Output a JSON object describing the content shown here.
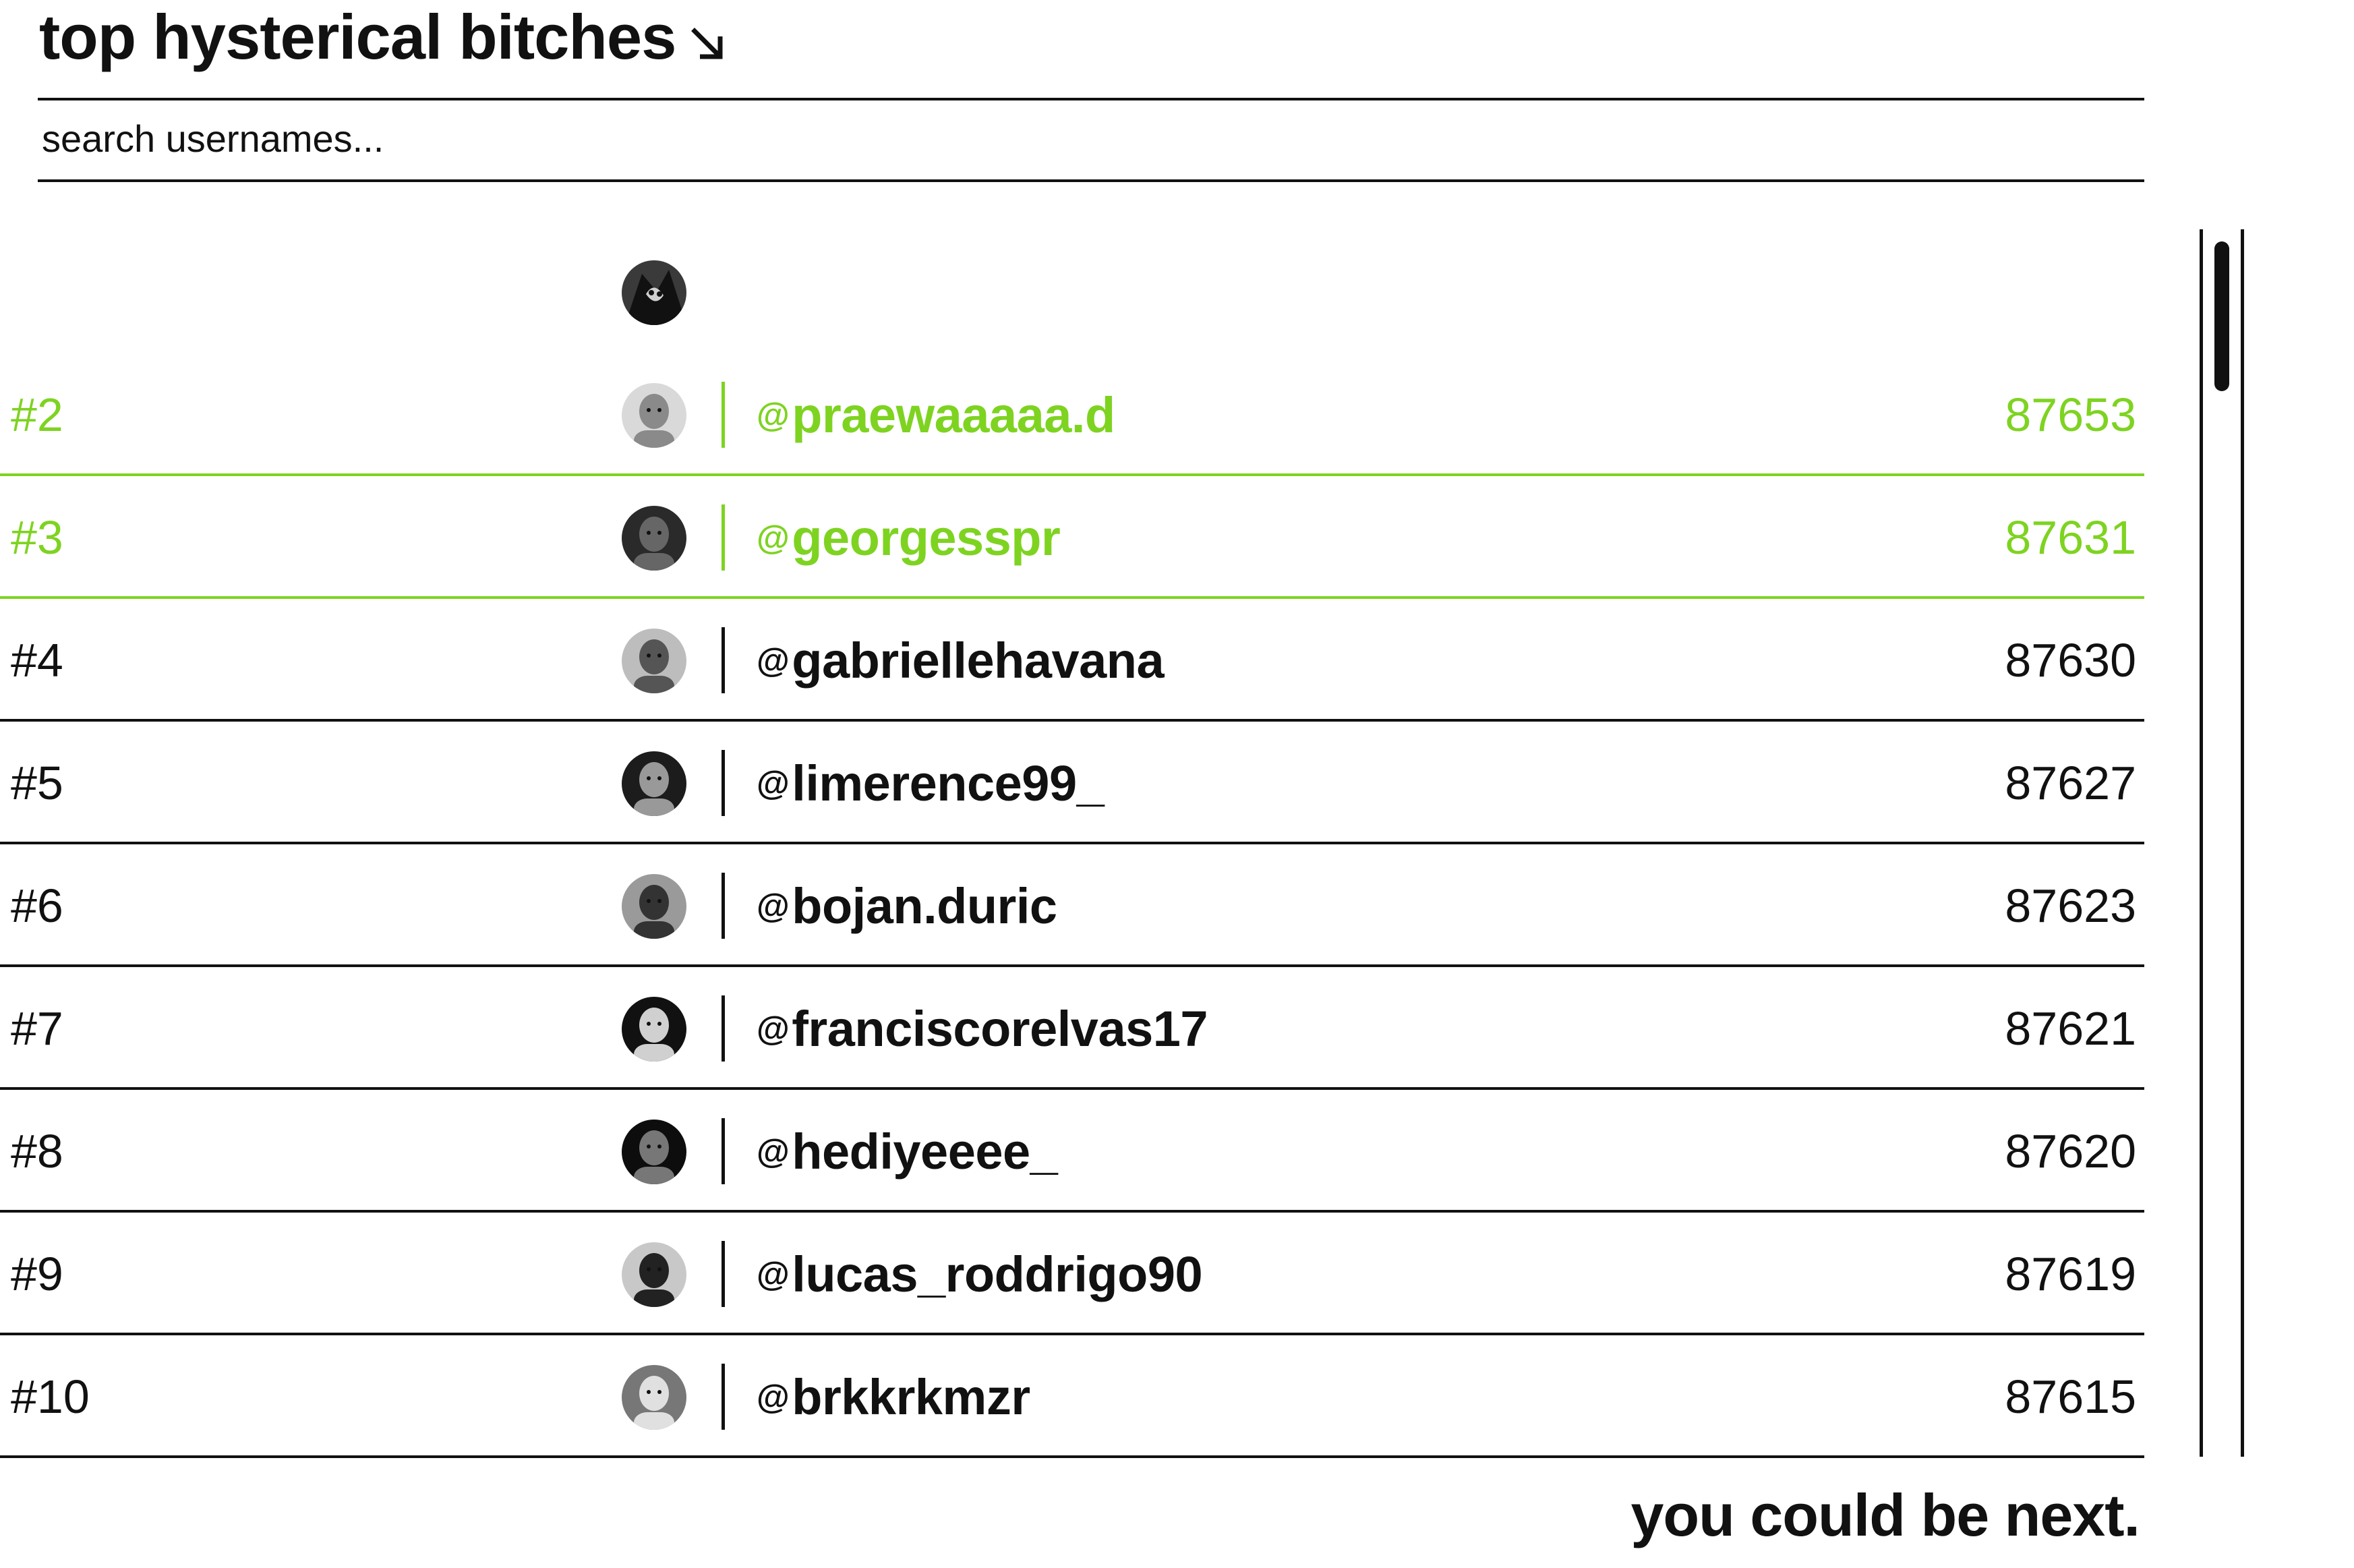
{
  "header": {
    "title": "top hysterical bitches",
    "title_icon": "arrow-down-right-icon"
  },
  "search": {
    "placeholder": "search usernames..."
  },
  "colors": {
    "accent": "#7ed321",
    "text": "#111111",
    "background": "#ffffff"
  },
  "leaderboard": {
    "top_avatar_icon": "avatar-rank-1",
    "rows": [
      {
        "rank": "#2",
        "at": "@",
        "username": "praewaaaaa.d",
        "score": "87653",
        "highlighted": true
      },
      {
        "rank": "#3",
        "at": "@",
        "username": "georgesspr",
        "score": "87631",
        "highlighted": true
      },
      {
        "rank": "#4",
        "at": "@",
        "username": "gabriellehavana",
        "score": "87630",
        "highlighted": false
      },
      {
        "rank": "#5",
        "at": "@",
        "username": "limerence99_",
        "score": "87627",
        "highlighted": false
      },
      {
        "rank": "#6",
        "at": "@",
        "username": "bojan.duric",
        "score": "87623",
        "highlighted": false
      },
      {
        "rank": "#7",
        "at": "@",
        "username": "franciscorelvas17",
        "score": "87621",
        "highlighted": false
      },
      {
        "rank": "#8",
        "at": "@",
        "username": "hediyeeee_",
        "score": "87620",
        "highlighted": false
      },
      {
        "rank": "#9",
        "at": "@",
        "username": "lucas_roddrigo90",
        "score": "87619",
        "highlighted": false
      },
      {
        "rank": "#10",
        "at": "@",
        "username": "brkkrkmzr",
        "score": "87615",
        "highlighted": false
      }
    ]
  },
  "footer": {
    "text": "you could be next."
  }
}
